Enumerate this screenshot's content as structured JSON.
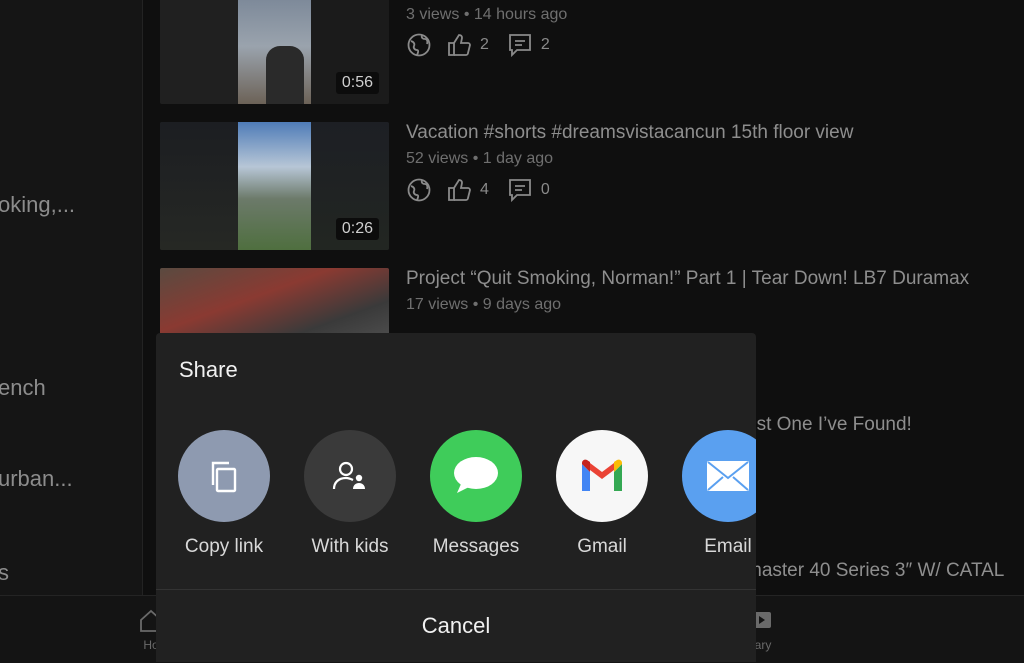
{
  "left_panel": {
    "items": [
      "oking,...",
      "ench",
      "urban...",
      "s"
    ]
  },
  "videos": [
    {
      "title": "",
      "views": "3 views",
      "age": "14 hours ago",
      "likes": "2",
      "comments": "2",
      "duration": "0:56"
    },
    {
      "title": "Vacation #shorts  #dreamsvistacancun 15th floor view",
      "views": "52 views",
      "age": "1 day ago",
      "likes": "4",
      "comments": "0",
      "duration": "0:26"
    },
    {
      "title": "Project “Quit Smoking, Norman!”  Part 1 | Tear Down!  LB7 Duramax",
      "views": "17 views",
      "age": "9 days ago",
      "likes": "",
      "comments": "",
      "duration": ""
    }
  ],
  "partial_rows": {
    "row1": "est One I’ve Found!",
    "row2": "master 40 Series 3″ W/ CATAL"
  },
  "bottom_nav": {
    "home_label": "Ho",
    "library_label": "rary"
  },
  "share_sheet": {
    "title": "Share",
    "options": [
      {
        "label": "Copy link",
        "icon": "copy-icon",
        "color": "#8e9ab0"
      },
      {
        "label": "With kids",
        "icon": "kids-icon",
        "color": "#3a3a3a"
      },
      {
        "label": "Messages",
        "icon": "messages-icon",
        "color": "#3fcc5a"
      },
      {
        "label": "Gmail",
        "icon": "gmail-icon",
        "color": "#f7f7f7"
      },
      {
        "label": "Email",
        "icon": "email-icon",
        "color": "#5aa0f0"
      }
    ],
    "cancel_label": "Cancel"
  }
}
